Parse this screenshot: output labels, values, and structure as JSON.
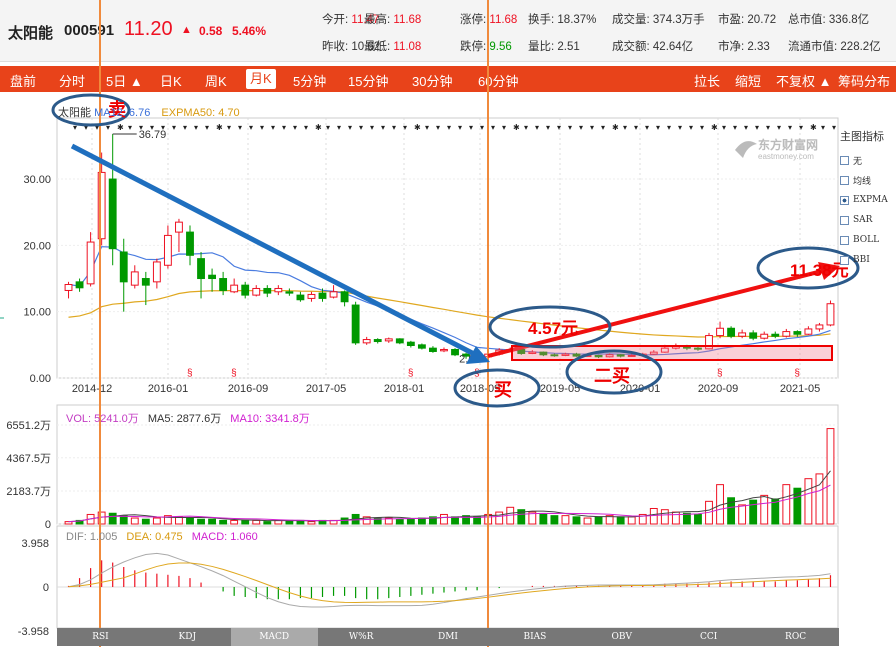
{
  "header": {
    "name": "太阳能",
    "code": "000591",
    "price": "11.20",
    "arrow": "▲",
    "change": "0.58",
    "change_pct": "5.46%",
    "stats": [
      {
        "label": "今开:",
        "value": "11.47",
        "color": "red"
      },
      {
        "label": "最高:",
        "value": "11.68",
        "color": "red"
      },
      {
        "label": "涨停:",
        "value": "11.68",
        "color": "red"
      },
      {
        "label": "换手:",
        "value": "18.37%",
        "color": "normal"
      },
      {
        "label": "成交量:",
        "value": "374.3万手",
        "color": "normal"
      },
      {
        "label": "市盈:",
        "value": "20.72",
        "color": "normal"
      },
      {
        "label": "总市值:",
        "value": "336.8亿",
        "color": "normal"
      },
      {
        "label": "昨收:",
        "value": "10.62",
        "color": "normal"
      },
      {
        "label": "最低:",
        "value": "11.08",
        "color": "red"
      },
      {
        "label": "跌停:",
        "value": "9.56",
        "color": "green"
      },
      {
        "label": "量比:",
        "value": "2.51",
        "color": "normal"
      },
      {
        "label": "成交额:",
        "value": "42.64亿",
        "color": "normal"
      },
      {
        "label": "市净:",
        "value": "2.33",
        "color": "normal"
      },
      {
        "label": "流通市值:",
        "value": "228.2亿",
        "color": "normal"
      }
    ]
  },
  "toolbar": {
    "items": [
      "盘前",
      "分时",
      "5日 ▲",
      "日K",
      "周K",
      "月K",
      "5分钟",
      "15分钟",
      "30分钟",
      "60分钟"
    ],
    "active": "月K",
    "right_items": [
      "拉长",
      "缩短",
      "不复权 ▲",
      "筹码分布"
    ]
  },
  "legend": {
    "main_name": "太阳能",
    "ma12": "MA12: 6.76",
    "expma50": "EXPMA50: 4.70",
    "vol": "VOL: 5241.0万",
    "ma5": "MA5: 2877.6万",
    "ma10": "MA10: 3341.8万",
    "dif": "DIF: 1.005",
    "dea": "DEA: 0.475",
    "macd": "MACD: 1.060"
  },
  "right_panel": {
    "title": "主图指标",
    "items": [
      "无",
      "均线",
      "EXPMA",
      "SAR",
      "BOLL",
      "BBI"
    ],
    "selected": "EXPMA"
  },
  "watermark": {
    "cn": "东方财富网",
    "en": "eastmoney.com"
  },
  "price_axis": [
    "30.00",
    "20.00",
    "10.00",
    "0.00"
  ],
  "vol_axis": [
    "6551.2万",
    "4367.5万",
    "2183.7万",
    "0"
  ],
  "macd_axis": [
    "3.958",
    "0",
    "-3.958"
  ],
  "x_axis": [
    "2014-12",
    "2016-01",
    "2016-09",
    "2017-05",
    "2018-01",
    "2018-09",
    "2019-05",
    "2020-01",
    "2020-09",
    "2021-05"
  ],
  "annotations": {
    "high": "36.79",
    "low": "2.65",
    "sell": "卖",
    "buy": "买",
    "second_buy": "二买",
    "price1": "4.57元",
    "price2": "11.38元"
  },
  "bottom_tabs": [
    "RSI",
    "KDJ",
    "MACD",
    "W%R",
    "DMI",
    "BIAS",
    "OBV",
    "CCI",
    "ROC"
  ],
  "bottom_active": "MACD",
  "colors": {
    "up": "#e12",
    "down": "#090",
    "toolbar": "#e8431a",
    "arrow_blue": "#1f6fbf",
    "arrow_red": "#f01010",
    "orange_line": "#f08a3c"
  },
  "chart_data": {
    "type": "candlestick",
    "ylim": [
      0,
      38
    ],
    "candles": [
      [
        13.2,
        14.1,
        12.0,
        14.5
      ],
      [
        14.5,
        13.6,
        13.0,
        15.0
      ],
      [
        14.2,
        20.5,
        13.8,
        22.0
      ],
      [
        21.0,
        31.0,
        20.0,
        34.0
      ],
      [
        30.0,
        19.5,
        17.0,
        36.79
      ],
      [
        19.0,
        14.5,
        10.0,
        21.0
      ],
      [
        14.0,
        16.0,
        13.5,
        17.0
      ],
      [
        15.0,
        14.0,
        11.0,
        16.0
      ],
      [
        14.5,
        17.5,
        13.5,
        18.0
      ],
      [
        17.0,
        21.5,
        16.5,
        23.0
      ],
      [
        22.0,
        23.5,
        19.0,
        24.0
      ],
      [
        22.0,
        18.5,
        17.0,
        23.0
      ],
      [
        18.0,
        15.0,
        12.0,
        19.0
      ],
      [
        15.5,
        15.0,
        13.0,
        16.5
      ],
      [
        15.0,
        13.2,
        12.5,
        16.0
      ],
      [
        13.0,
        14.0,
        12.8,
        15.0
      ],
      [
        14.0,
        12.5,
        12.0,
        14.5
      ],
      [
        12.5,
        13.5,
        12.3,
        14.0
      ],
      [
        13.5,
        12.8,
        12.2,
        14.0
      ],
      [
        13.0,
        13.5,
        12.5,
        14.0
      ],
      [
        13.0,
        12.8,
        12.4,
        13.5
      ],
      [
        12.5,
        11.8,
        11.5,
        13.0
      ],
      [
        12.0,
        12.6,
        11.5,
        13.0
      ],
      [
        12.8,
        12.0,
        11.5,
        13.5
      ],
      [
        12.2,
        13.0,
        12.0,
        14.0
      ],
      [
        13.0,
        11.5,
        10.8,
        13.2
      ],
      [
        11.0,
        5.3,
        5.0,
        11.5
      ],
      [
        5.3,
        5.8,
        5.0,
        6.2
      ],
      [
        5.8,
        5.5,
        5.2,
        6.0
      ],
      [
        5.6,
        5.9,
        5.3,
        6.1
      ],
      [
        5.9,
        5.3,
        5.1,
        6.0
      ],
      [
        5.4,
        4.9,
        4.6,
        5.6
      ],
      [
        5.0,
        4.5,
        4.3,
        5.2
      ],
      [
        4.5,
        4.0,
        3.8,
        4.8
      ],
      [
        4.1,
        4.3,
        3.9,
        4.6
      ],
      [
        4.3,
        3.5,
        3.3,
        4.5
      ],
      [
        3.6,
        3.3,
        2.9,
        3.8
      ],
      [
        3.3,
        3.1,
        2.65,
        3.5
      ],
      [
        3.2,
        3.6,
        3.0,
        3.8
      ],
      [
        3.6,
        4.2,
        3.4,
        4.5
      ],
      [
        4.2,
        4.3,
        3.9,
        4.6
      ],
      [
        4.3,
        3.7,
        3.5,
        4.5
      ],
      [
        3.7,
        3.9,
        3.6,
        4.2
      ],
      [
        3.9,
        3.5,
        3.3,
        4.0
      ],
      [
        3.5,
        3.4,
        3.2,
        3.7
      ],
      [
        3.4,
        3.6,
        3.3,
        3.8
      ],
      [
        3.6,
        3.3,
        3.2,
        3.8
      ],
      [
        3.3,
        3.4,
        3.2,
        3.6
      ],
      [
        3.4,
        3.2,
        3.0,
        3.5
      ],
      [
        3.2,
        3.5,
        3.1,
        3.7
      ],
      [
        3.5,
        3.3,
        3.1,
        3.6
      ],
      [
        3.3,
        3.4,
        3.2,
        3.6
      ],
      [
        3.4,
        3.6,
        3.3,
        3.8
      ],
      [
        3.6,
        3.9,
        3.5,
        4.2
      ],
      [
        3.9,
        4.5,
        3.8,
        5.0
      ],
      [
        4.5,
        4.8,
        4.3,
        5.2
      ],
      [
        4.8,
        4.5,
        4.2,
        5.0
      ],
      [
        4.5,
        4.4,
        4.1,
        4.8
      ],
      [
        4.4,
        6.4,
        4.3,
        6.8
      ],
      [
        6.4,
        7.5,
        6.0,
        8.5
      ],
      [
        7.5,
        6.3,
        6.0,
        7.8
      ],
      [
        6.3,
        6.8,
        6.0,
        7.3
      ],
      [
        6.8,
        6.0,
        5.7,
        7.2
      ],
      [
        6.0,
        6.6,
        5.8,
        7.0
      ],
      [
        6.6,
        6.3,
        6.0,
        7.0
      ],
      [
        6.3,
        7.0,
        6.1,
        7.4
      ],
      [
        7.0,
        6.6,
        6.2,
        7.2
      ],
      [
        6.6,
        7.4,
        6.5,
        7.8
      ],
      [
        7.4,
        8.0,
        7.0,
        8.3
      ],
      [
        8.0,
        11.2,
        7.8,
        11.68
      ]
    ],
    "volume": [
      0.02,
      0.03,
      0.08,
      0.1,
      0.09,
      0.07,
      0.05,
      0.04,
      0.05,
      0.07,
      0.06,
      0.05,
      0.04,
      0.04,
      0.03,
      0.03,
      0.03,
      0.03,
      0.02,
      0.03,
      0.03,
      0.03,
      0.02,
      0.03,
      0.03,
      0.05,
      0.08,
      0.06,
      0.05,
      0.05,
      0.04,
      0.04,
      0.05,
      0.06,
      0.08,
      0.06,
      0.07,
      0.06,
      0.08,
      0.1,
      0.14,
      0.12,
      0.1,
      0.08,
      0.07,
      0.07,
      0.06,
      0.05,
      0.06,
      0.07,
      0.06,
      0.06,
      0.08,
      0.13,
      0.12,
      0.1,
      0.09,
      0.08,
      0.19,
      0.33,
      0.22,
      0.16,
      0.2,
      0.24,
      0.21,
      0.33,
      0.3,
      0.38,
      0.42,
      0.8
    ],
    "macd_hist": [
      0.1,
      0.8,
      1.7,
      2.4,
      2.2,
      1.8,
      1.5,
      1.3,
      1.2,
      1.1,
      1.0,
      0.8,
      0.4,
      0.0,
      -0.4,
      -0.8,
      -0.9,
      -1.0,
      -1.1,
      -1.1,
      -1.1,
      -1.0,
      -1.0,
      -0.9,
      -0.8,
      -0.8,
      -1.0,
      -1.1,
      -1.1,
      -1.0,
      -0.9,
      -0.8,
      -0.7,
      -0.6,
      -0.5,
      -0.4,
      -0.3,
      -0.3,
      -0.2,
      -0.1,
      0.0,
      0.0,
      0.1,
      0.1,
      0.1,
      0.1,
      0.1,
      0.1,
      0.1,
      0.1,
      0.1,
      0.1,
      0.1,
      0.2,
      0.3,
      0.3,
      0.3,
      0.3,
      0.4,
      0.5,
      0.5,
      0.5,
      0.5,
      0.5,
      0.5,
      0.6,
      0.6,
      0.7,
      0.8,
      1.06
    ]
  }
}
